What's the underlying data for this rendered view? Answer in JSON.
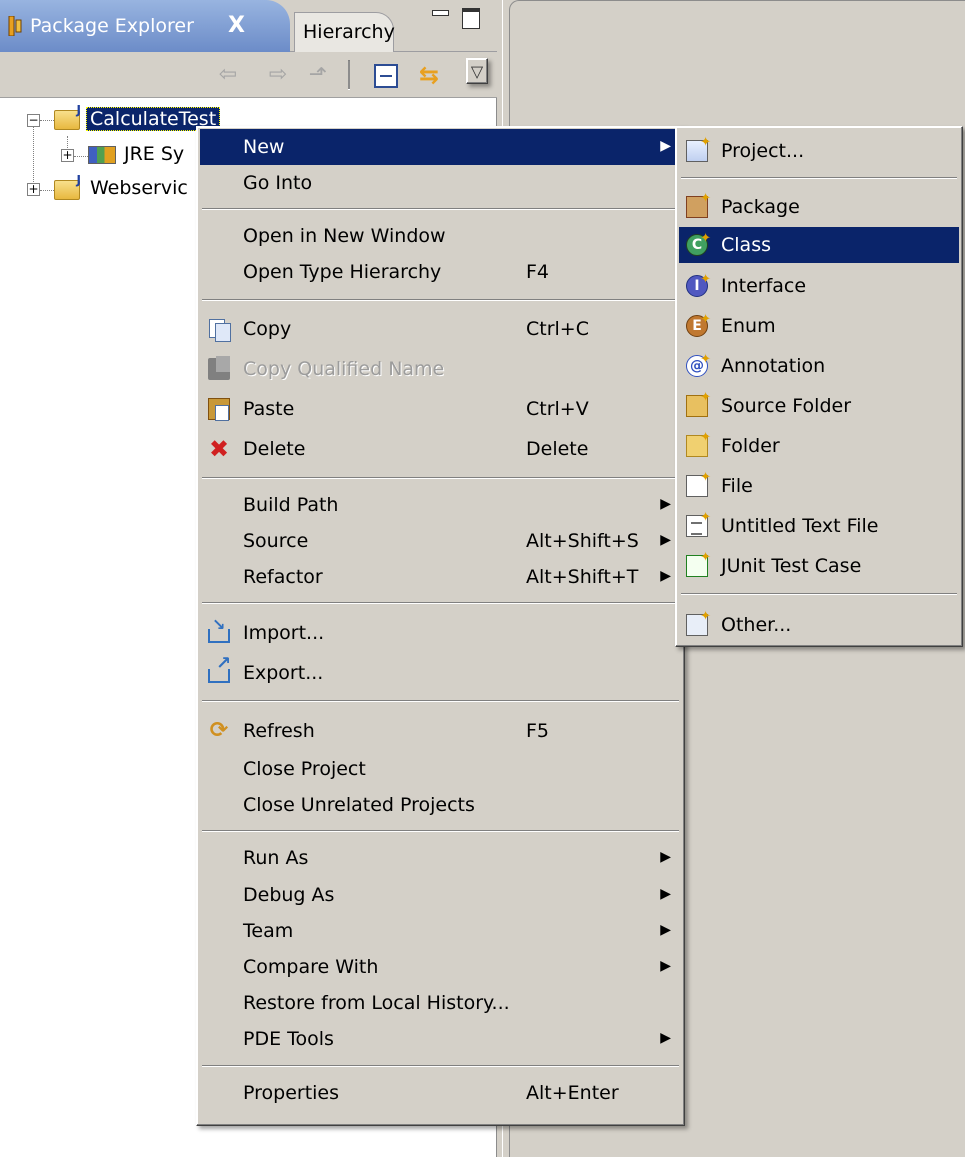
{
  "view": {
    "active_tab": "Package Explorer",
    "close_glyph": "X",
    "inactive_tab": "Hierarchy"
  },
  "toolbar": {
    "back_glyph": "⇦",
    "forward_glyph": "⇨",
    "up_glyph": "⬏",
    "link_glyph": "⇆",
    "menu_glyph": "▽"
  },
  "tree": {
    "items": [
      {
        "label": "CalculateTest",
        "selected": true
      },
      {
        "label": "JRE Sy"
      },
      {
        "label": "Webservic"
      }
    ]
  },
  "context_menu": {
    "items": [
      {
        "label": "New",
        "accel": "",
        "arrow": "▶"
      },
      {
        "label": "Go Into",
        "accel": ""
      },
      {
        "label": "Open in New Window",
        "accel": ""
      },
      {
        "label": "Open Type Hierarchy",
        "accel": "F4"
      },
      {
        "label": "Copy",
        "accel": "Ctrl+C",
        "icon": "copy-icon"
      },
      {
        "label": "Copy Qualified Name",
        "accel": "",
        "icon": "copy-qualified-name-icon"
      },
      {
        "label": "Paste",
        "accel": "Ctrl+V",
        "icon": "paste-icon"
      },
      {
        "label": "Delete",
        "accel": "Delete",
        "icon": "delete-icon"
      },
      {
        "label": "Build Path",
        "accel": "",
        "arrow": "▶"
      },
      {
        "label": "Source",
        "accel": "Alt+Shift+S",
        "arrow": "▶"
      },
      {
        "label": "Refactor",
        "accel": "Alt+Shift+T",
        "arrow": "▶"
      },
      {
        "label": "Import...",
        "accel": "",
        "icon": "import-icon"
      },
      {
        "label": "Export...",
        "accel": "",
        "icon": "export-icon"
      },
      {
        "label": "Refresh",
        "accel": "F5",
        "icon": "refresh-icon"
      },
      {
        "label": "Close Project",
        "accel": ""
      },
      {
        "label": "Close Unrelated Projects",
        "accel": ""
      },
      {
        "label": "Run As",
        "accel": "",
        "arrow": "▶"
      },
      {
        "label": "Debug As",
        "accel": "",
        "arrow": "▶"
      },
      {
        "label": "Team",
        "accel": "",
        "arrow": "▶"
      },
      {
        "label": "Compare With",
        "accel": "",
        "arrow": "▶"
      },
      {
        "label": "Restore from Local History...",
        "accel": ""
      },
      {
        "label": "PDE Tools",
        "accel": "",
        "arrow": "▶"
      },
      {
        "label": "Properties",
        "accel": "Alt+Enter"
      }
    ]
  },
  "submenu": {
    "items": [
      {
        "label": "Project...",
        "icon": "project-icon"
      },
      {
        "label": "Package",
        "icon": "package-icon"
      },
      {
        "label": "Class",
        "icon": "class-icon",
        "glyph": "C"
      },
      {
        "label": "Interface",
        "icon": "interface-icon",
        "glyph": "I"
      },
      {
        "label": "Enum",
        "icon": "enum-icon",
        "glyph": "E"
      },
      {
        "label": "Annotation",
        "icon": "annotation-icon",
        "glyph": "@"
      },
      {
        "label": "Source Folder",
        "icon": "source-folder-icon"
      },
      {
        "label": "Folder",
        "icon": "folder-icon"
      },
      {
        "label": "File",
        "icon": "file-icon"
      },
      {
        "label": "Untitled Text File",
        "icon": "text-file-icon"
      },
      {
        "label": "JUnit Test Case",
        "icon": "junit-test-case-icon"
      },
      {
        "label": "Other...",
        "icon": "other-icon"
      }
    ]
  },
  "colors": {
    "menu_bg": "#d4d0c8",
    "highlight": "#0a246a",
    "tab_active": "#6c8cc8"
  }
}
